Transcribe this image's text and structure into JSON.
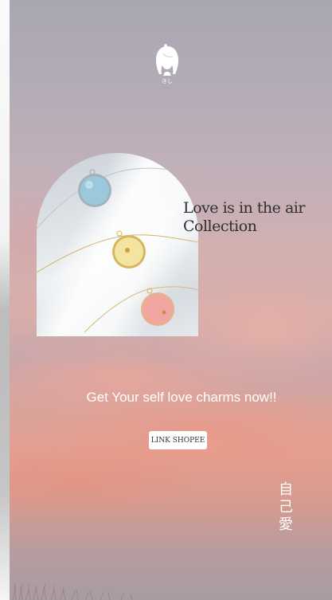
{
  "brand": {
    "logo_caption": "きし"
  },
  "collection": {
    "title": "Love is in the air Collection"
  },
  "cta": {
    "tagline": "Get Your self love charms now!!",
    "button_label": "LINK SHOPEE"
  },
  "vertical_text": {
    "chars": [
      "自",
      "己",
      "愛"
    ]
  },
  "colors": {
    "text_dark": "#2f2f33",
    "button_bg": "#ffffff",
    "text_light": "#ffffff"
  },
  "icons": {
    "logo": "girl-silhouette-icon"
  }
}
